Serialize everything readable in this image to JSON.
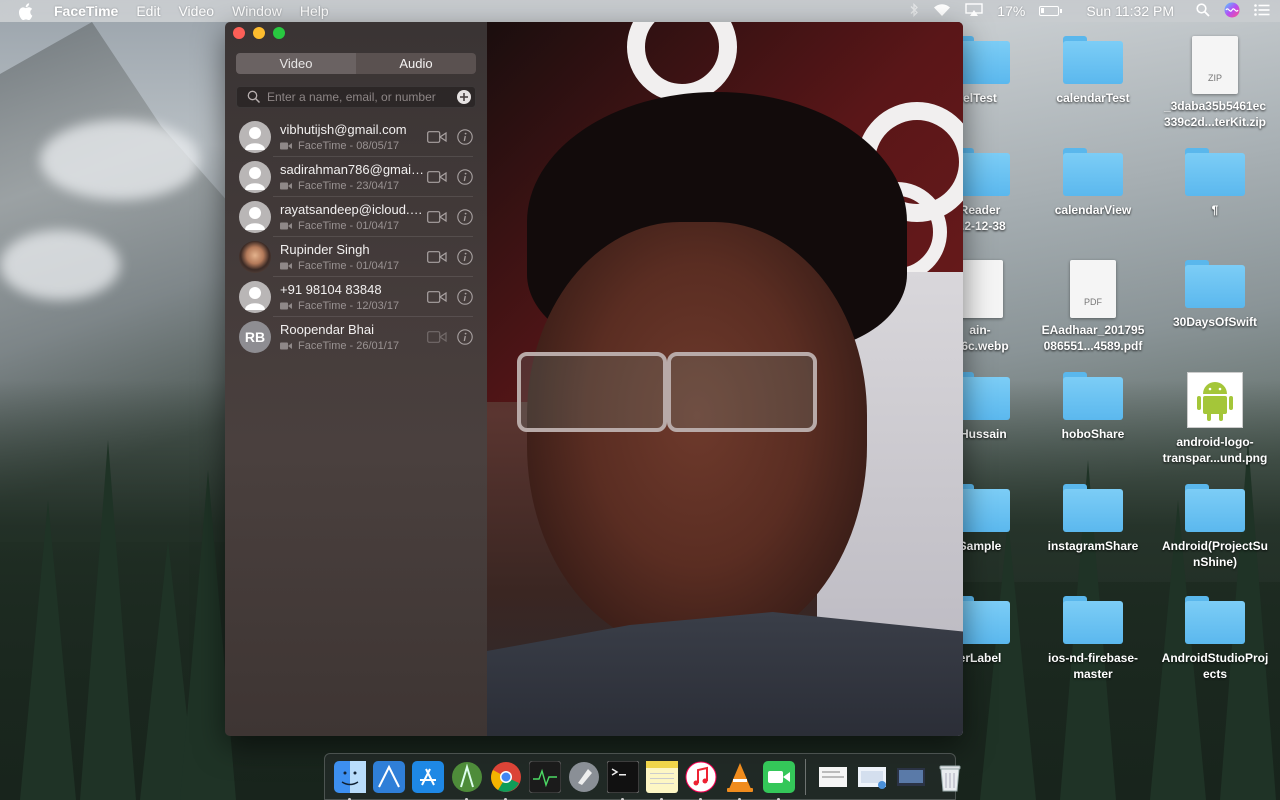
{
  "menubar": {
    "app_name": "FaceTime",
    "menus": [
      "Edit",
      "Video",
      "Window",
      "Help"
    ],
    "battery_percent": "17%",
    "battery_level": 0.17,
    "clock": "Sun 11:32 PM"
  },
  "facetime": {
    "segments": {
      "video": "Video",
      "audio": "Audio",
      "selected": "Audio"
    },
    "search_placeholder": "Enter a name, email, or number",
    "contacts": [
      {
        "name": "vibhutijsh@gmail.com",
        "detail": "FaceTime - 08/05/17",
        "avatar": "person-icon",
        "initials": ""
      },
      {
        "name": "sadirahman786@gmail....",
        "detail": "FaceTime - 23/04/17",
        "avatar": "person-icon",
        "initials": ""
      },
      {
        "name": "rayatsandeep@icloud.c...",
        "detail": "FaceTime - 01/04/17",
        "avatar": "person-icon",
        "initials": ""
      },
      {
        "name": "Rupinder Singh",
        "detail": "FaceTime - 01/04/17",
        "avatar": "photo",
        "initials": ""
      },
      {
        "name": "+91 98104 83848",
        "detail": "FaceTime - 12/03/17",
        "avatar": "person-icon",
        "initials": ""
      },
      {
        "name": "Roopendar Bhai",
        "detail": "FaceTime - 26/01/17",
        "avatar": "initials",
        "initials": "RB"
      }
    ]
  },
  "desktop": {
    "icons": [
      {
        "label_lines": [
          "elTest"
        ],
        "kind": "folder"
      },
      {
        "label_lines": [
          "calendarTest"
        ],
        "kind": "folder"
      },
      {
        "label_lines": [
          "_3daba35b5461ec",
          "339c2d...terKit.zip"
        ],
        "kind": "zip",
        "tag": "ZIP"
      },
      {
        "label_lines": [
          "Reader",
          "...2-12-38"
        ],
        "kind": "folder"
      },
      {
        "label_lines": [
          "calendarView"
        ],
        "kind": "folder"
      },
      {
        "label_lines": [
          "¶"
        ],
        "kind": "folder"
      },
      {
        "label_lines": [
          "ain-",
          "...6c.webp"
        ],
        "kind": "doc"
      },
      {
        "label_lines": [
          "EAadhaar_201795",
          "086551...4589.pdf"
        ],
        "kind": "pdf",
        "tag": "PDF"
      },
      {
        "label_lines": [
          "30DaysOfSwift"
        ],
        "kind": "folder"
      },
      {
        "label_lines": [
          "_Hussain"
        ],
        "kind": "folder"
      },
      {
        "label_lines": [
          "hoboShare"
        ],
        "kind": "folder"
      },
      {
        "label_lines": [
          "android-logo-",
          "transpar...und.png"
        ],
        "kind": "android"
      },
      {
        "label_lines": [
          "Sample"
        ],
        "kind": "folder"
      },
      {
        "label_lines": [
          "instagramShare"
        ],
        "kind": "folder"
      },
      {
        "label_lines": [
          "Android(ProjectSu",
          "nShine)"
        ],
        "kind": "folder"
      },
      {
        "label_lines": [
          "erLabel"
        ],
        "kind": "folder"
      },
      {
        "label_lines": [
          "ios-nd-firebase-",
          "master"
        ],
        "kind": "folder"
      },
      {
        "label_lines": [
          "AndroidStudioProj",
          "ects"
        ],
        "kind": "folder"
      }
    ]
  },
  "dock": {
    "items": [
      {
        "name": "finder-icon",
        "running": true
      },
      {
        "name": "xcode-icon",
        "running": false
      },
      {
        "name": "app-store-icon",
        "running": false
      },
      {
        "name": "android-studio-icon",
        "running": true
      },
      {
        "name": "chrome-icon",
        "running": true
      },
      {
        "name": "activity-monitor-icon",
        "running": false
      },
      {
        "name": "launchpad-icon",
        "running": false
      },
      {
        "name": "terminal-icon",
        "running": true
      },
      {
        "name": "notes-icon",
        "running": true
      },
      {
        "name": "itunes-icon",
        "running": true
      },
      {
        "name": "vlc-icon",
        "running": true
      },
      {
        "name": "facetime-icon",
        "running": true
      }
    ],
    "stacks": [
      "documents-stack-icon",
      "downloads-stack-icon",
      "screenshots-stack-icon",
      "trash-icon"
    ]
  }
}
